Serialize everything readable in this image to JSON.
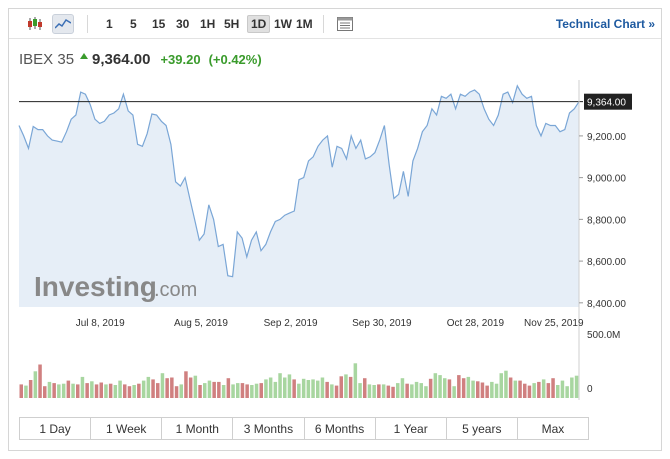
{
  "toolbar": {
    "chart_type_icons": [
      "candlestick-icon",
      "line-chart-icon"
    ],
    "timeframes": [
      "1",
      "5",
      "15",
      "30",
      "1H",
      "5H",
      "1D",
      "1W",
      "1M"
    ],
    "active_timeframe": "1D",
    "settings_icon": "settings-panel-icon",
    "technical_link": "Technical Chart »"
  },
  "quote": {
    "name": "IBEX 35",
    "price": "9,364.00",
    "change": "+39.20",
    "change_pct": "(+0.42%)",
    "direction": "up",
    "up_color": "#3a9b2c"
  },
  "watermark": {
    "brand": "Investing",
    "suffix": ".com"
  },
  "chart_data": [
    {
      "type": "area",
      "title": "",
      "x_tick_labels": [
        "Jul 8, 2019",
        "Aug 5, 2019",
        "Sep 2, 2019",
        "Sep 30, 2019",
        "Oct 28, 2019",
        "Nov 25, 2019"
      ],
      "y_tick_labels": [
        "9,200.00",
        "9,000.00",
        "8,800.00",
        "8,600.00",
        "8,400.00"
      ],
      "y_ticks": [
        9200,
        9000,
        8800,
        8600,
        8400
      ],
      "ylim": [
        8380,
        9420
      ],
      "current_value": 9364,
      "current_label": "9,364.00",
      "line_color": "#7aa6d6",
      "fill_color": "#e6eef7",
      "values": [
        9250,
        9200,
        9140,
        9245,
        9230,
        9230,
        9200,
        9180,
        9175,
        9170,
        9220,
        9280,
        9300,
        9410,
        9400,
        9350,
        9280,
        9260,
        9270,
        9300,
        9310,
        9330,
        9400,
        9320,
        9300,
        9160,
        9150,
        9210,
        9305,
        9300,
        9270,
        9250,
        9160,
        8980,
        8960,
        9000,
        8900,
        8800,
        8700,
        8730,
        8870,
        8800,
        8670,
        8680,
        8530,
        8525,
        8740,
        8710,
        8620,
        8700,
        8740,
        8650,
        8680,
        8740,
        8790,
        8800,
        8820,
        8830,
        8840,
        8990,
        9000,
        9080,
        9100,
        9150,
        9180,
        9200,
        9050,
        9150,
        9140,
        9090,
        9200,
        9140,
        9180,
        9090,
        9100,
        9120,
        9180,
        9250,
        9060,
        8900,
        8920,
        9030,
        8910,
        9080,
        9140,
        9220,
        9250,
        9330,
        9300,
        9390,
        9380,
        9400,
        9330,
        9400,
        9390,
        9410,
        9420,
        9400,
        9330,
        9280,
        9250,
        9300,
        9400,
        9410,
        9360,
        9440,
        9400,
        9380,
        9390,
        9250,
        9200,
        9260,
        9250,
        9250,
        9220,
        9230,
        9310,
        9330,
        9364
      ]
    },
    {
      "type": "bar",
      "title": "",
      "y_tick_labels": [
        "500.0M",
        "0"
      ],
      "ylim": [
        0,
        500
      ],
      "unit": "M",
      "up_color": "#a8d6a0",
      "down_color": "#d08080",
      "values": [
        110,
        100,
        145,
        215,
        270,
        95,
        130,
        120,
        110,
        115,
        140,
        115,
        110,
        170,
        120,
        135,
        110,
        125,
        110,
        115,
        105,
        140,
        110,
        95,
        105,
        115,
        140,
        170,
        150,
        120,
        200,
        160,
        165,
        95,
        110,
        215,
        165,
        180,
        105,
        120,
        140,
        130,
        130,
        105,
        160,
        110,
        120,
        120,
        110,
        105,
        115,
        120,
        150,
        165,
        130,
        200,
        165,
        190,
        150,
        115,
        155,
        145,
        150,
        140,
        165,
        130,
        110,
        100,
        175,
        190,
        170,
        280,
        120,
        160,
        110,
        105,
        110,
        110,
        100,
        90,
        120,
        160,
        115,
        110,
        130,
        120,
        95,
        155,
        200,
        185,
        160,
        150,
        95,
        185,
        160,
        170,
        140,
        135,
        125,
        100,
        130,
        115,
        200,
        220,
        165,
        140,
        140,
        115,
        100,
        120,
        130,
        150,
        120,
        160,
        105,
        140,
        95,
        165,
        180
      ],
      "directions": [
        0,
        1,
        0,
        1,
        0,
        0,
        1,
        0,
        1,
        1,
        0,
        1,
        0,
        1,
        0,
        1,
        0,
        0,
        1,
        0,
        1,
        1,
        0,
        0,
        1,
        0,
        1,
        1,
        0,
        0,
        1,
        0,
        0,
        0,
        1,
        0,
        0,
        1,
        0,
        1,
        1,
        0,
        0,
        1,
        0,
        1,
        1,
        0,
        0,
        1,
        1,
        0,
        1,
        1,
        1,
        1,
        1,
        1,
        0,
        1,
        1,
        1,
        1,
        1,
        1,
        0,
        1,
        0,
        0,
        1,
        0,
        1,
        1,
        0,
        1,
        1,
        0,
        1,
        0,
        0,
        1,
        1,
        0,
        1,
        1,
        1,
        1,
        0,
        1,
        1,
        1,
        0,
        1,
        0,
        0,
        1,
        1,
        0,
        0,
        0,
        1,
        1,
        1,
        1,
        0,
        1,
        0,
        0,
        0,
        1,
        0,
        1,
        0,
        0,
        1,
        1,
        1,
        1,
        1
      ]
    }
  ],
  "ranges": [
    "1 Day",
    "1 Week",
    "1 Month",
    "3 Months",
    "6 Months",
    "1 Year",
    "5 years",
    "Max"
  ]
}
